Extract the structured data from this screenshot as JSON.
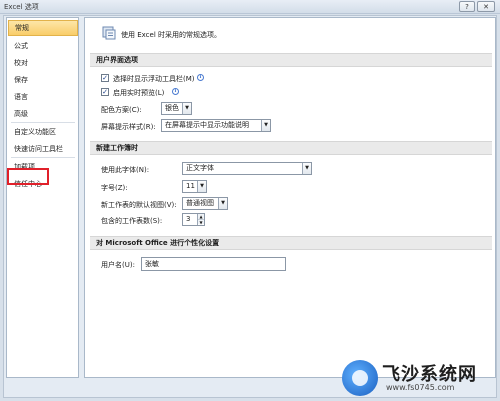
{
  "window": {
    "title": "Excel 选项",
    "help_glyph": "?",
    "close_glyph": "✕"
  },
  "sidebar": {
    "items": [
      {
        "label": "常规",
        "selected": true
      },
      {
        "label": "公式"
      },
      {
        "label": "校对"
      },
      {
        "label": "保存"
      },
      {
        "label": "语言"
      },
      {
        "label": "高级"
      },
      {
        "label": "自定义功能区"
      },
      {
        "label": "快速访问工具栏"
      },
      {
        "label": "加载项"
      },
      {
        "label": "信任中心",
        "highlighted": true
      }
    ]
  },
  "main": {
    "intro": "使用 Excel 时采用的常规选项。",
    "ui_section": {
      "header": "用户界面选项",
      "show_mini_toolbar": {
        "label": "选择时显示浮动工具栏(M)",
        "checked": true
      },
      "live_preview": {
        "label": "启用实时预览(L)",
        "checked": true
      },
      "color_scheme": {
        "label": "配色方案(C):",
        "value": "银色"
      },
      "screentip_style": {
        "label": "屏幕提示样式(R):",
        "value": "在屏幕提示中显示功能说明"
      }
    },
    "new_workbook_section": {
      "header": "新建工作簿时",
      "font": {
        "label": "使用此字体(N):",
        "value": "正文字体"
      },
      "font_size": {
        "label": "字号(Z):",
        "value": "11"
      },
      "default_view": {
        "label": "新工作表的默认视图(V):",
        "value": "普通视图"
      },
      "sheet_count": {
        "label": "包含的工作表数(S):",
        "value": "3"
      }
    },
    "personalize_section": {
      "header": "对 Microsoft Office 进行个性化设置",
      "username": {
        "label": "用户名(U):",
        "value": "张敏"
      }
    }
  },
  "watermark": {
    "title": "飞沙系统网",
    "url": "www.fs0745.com"
  },
  "colors": {
    "selected_bg": "#f9cd6a",
    "highlight_border": "#e0202a",
    "frame_bg": "#e4ebf3"
  }
}
